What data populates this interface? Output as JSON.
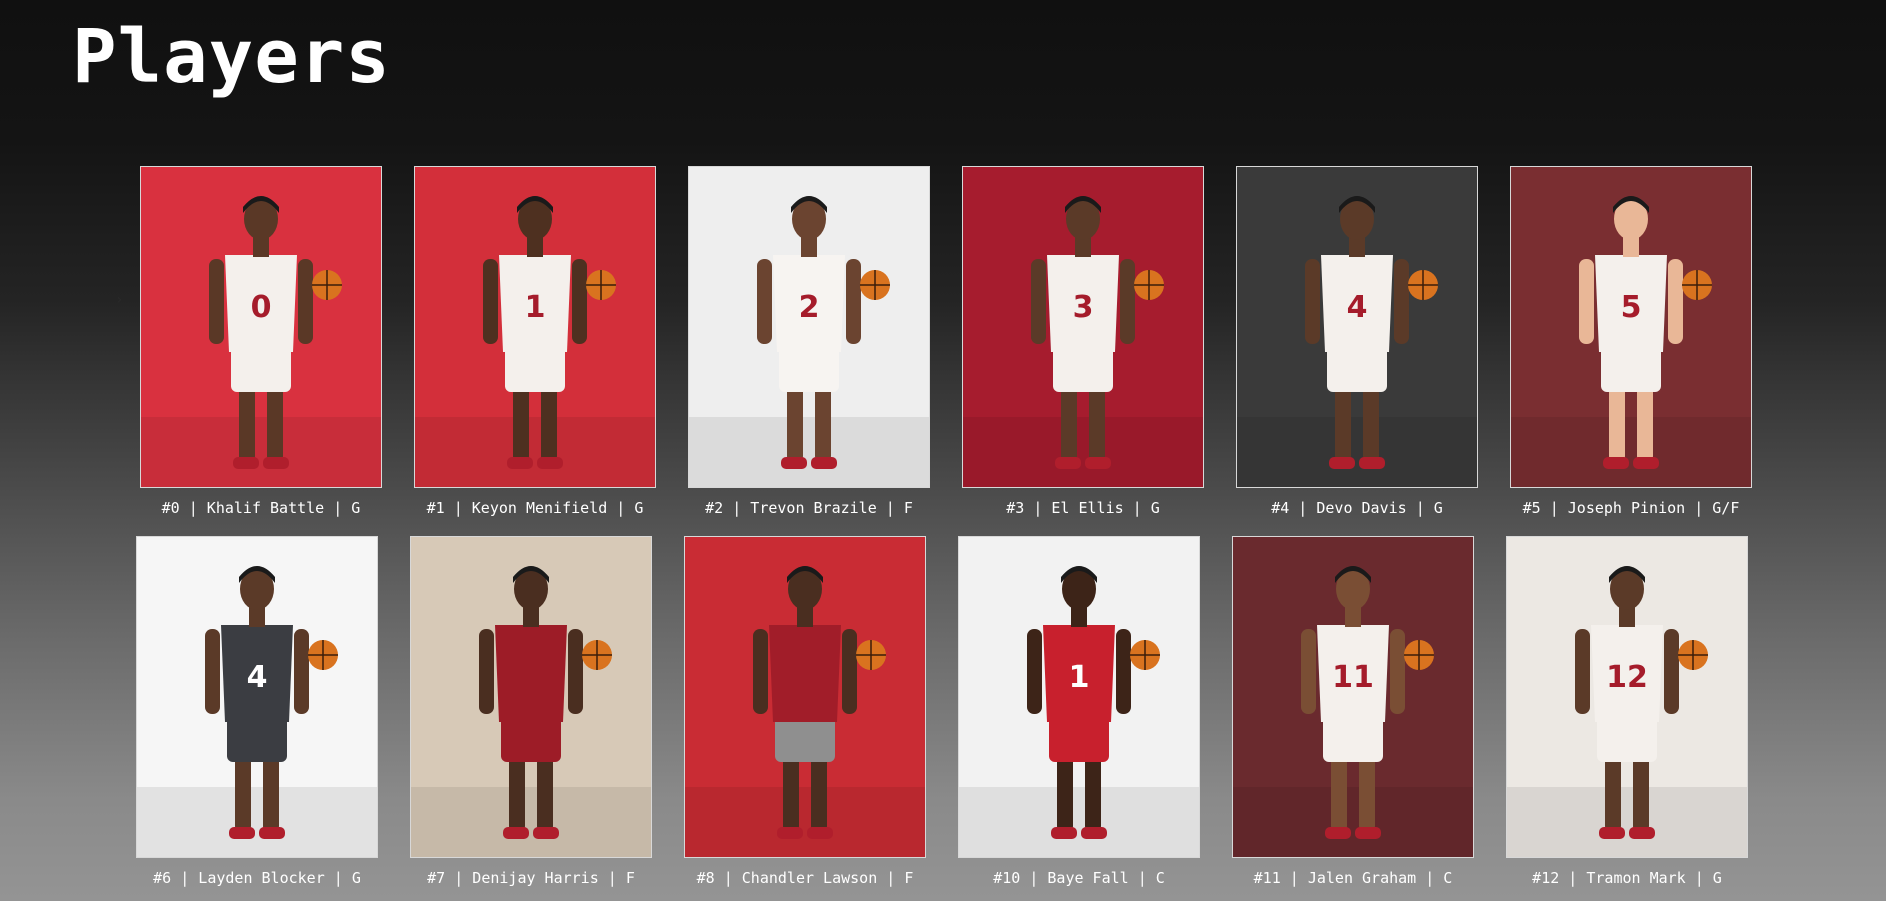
{
  "page": {
    "title": "Players"
  },
  "players": [
    {
      "caption": "#0 | Khalif Battle | G",
      "bg": "#d9313f",
      "jersey": "#f4f0ec",
      "shorts": "#f4f0ec",
      "number": "0",
      "skin": "#5a3826"
    },
    {
      "caption": "#1 | Keyon Menifield | G",
      "bg": "#d32f3a",
      "jersey": "#f4f0ec",
      "shorts": "#f4f0ec",
      "number": "1",
      "skin": "#4e3020"
    },
    {
      "caption": "#2 | Trevon Brazile | F",
      "bg": "#eeeeee",
      "jersey": "#f7f4f1",
      "shorts": "#f7f4f1",
      "number": "2",
      "skin": "#6b4430"
    },
    {
      "caption": "#3 | El Ellis | G",
      "bg": "#a61c2e",
      "jersey": "#f4f0ec",
      "shorts": "#f4f0ec",
      "number": "3",
      "skin": "#5b3a28"
    },
    {
      "caption": "#4 | Devo Davis | G",
      "bg": "#3a3a3a",
      "jersey": "#f4f0ec",
      "shorts": "#f4f0ec",
      "number": "4",
      "skin": "#5b3a28"
    },
    {
      "caption": "#5 | Joseph Pinion | G/F",
      "bg": "#7a2e31",
      "jersey": "#f4f0ec",
      "shorts": "#f4f0ec",
      "number": "5",
      "skin": "#e9b797"
    },
    {
      "caption": "#6 | Layden Blocker | G",
      "bg": "#f6f6f6",
      "jersey": "#3b3d42",
      "shorts": "#3b3d42",
      "number": "4",
      "skin": "#5b3a28"
    },
    {
      "caption": "#7 | Denijay Harris | F",
      "bg": "#d7c9b7",
      "jersey": "#9d1c27",
      "shorts": "#9d1c27",
      "number": "",
      "skin": "#4a2e20"
    },
    {
      "caption": "#8 | Chandler Lawson | F",
      "bg": "#c92c34",
      "jersey": "#a11d29",
      "shorts": "#8f8f8f",
      "number": "",
      "skin": "#4a2e20"
    },
    {
      "caption": "#10 | Baye Fall | C",
      "bg": "#f2f2f2",
      "jersey": "#c8202d",
      "shorts": "#c8202d",
      "number": "1",
      "skin": "#3d2418"
    },
    {
      "caption": "#11 | Jalen Graham | C",
      "bg": "#6a2a2e",
      "jersey": "#f4f0ec",
      "shorts": "#f4f0ec",
      "number": "11",
      "skin": "#7a4e34"
    },
    {
      "caption": "#12 | Tramon Mark | G",
      "bg": "#ece8e3",
      "jersey": "#f4f0ec",
      "shorts": "#f4f0ec",
      "number": "12",
      "skin": "#5b3a28"
    }
  ]
}
